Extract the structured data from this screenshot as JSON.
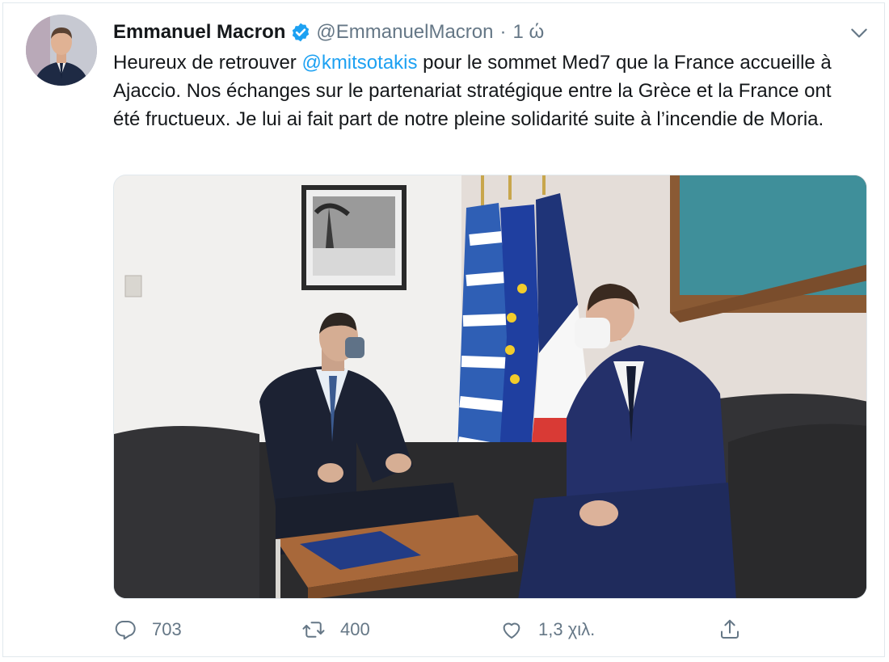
{
  "tweet": {
    "author": {
      "display_name": "Emmanuel Macron",
      "verified_icon": "verified-badge-icon",
      "handle": "@EmmanuelMacron",
      "separator": "·",
      "time": "1 ώ"
    },
    "text": {
      "part1": "Heureux de retrouver ",
      "mention": "@kmitsotakis",
      "part2": " pour le sommet Med7 que la France accueille à Ajaccio. Nos échanges sur le partenariat stratégique entre la Grèce et la France ont été fructueux. Je lui ai fait part de notre pleine solidarité suite à l’incendie de Moria."
    },
    "actions": {
      "reply_count": "703",
      "retweet_count": "400",
      "like_count": "1,3 χιλ.",
      "icons": [
        "reply-icon",
        "retweet-icon",
        "like-icon",
        "share-icon"
      ]
    }
  },
  "colors": {
    "link": "#1da1f2",
    "secondary_text": "#657786",
    "primary_text": "#14171a",
    "border": "#e1e8ed"
  }
}
